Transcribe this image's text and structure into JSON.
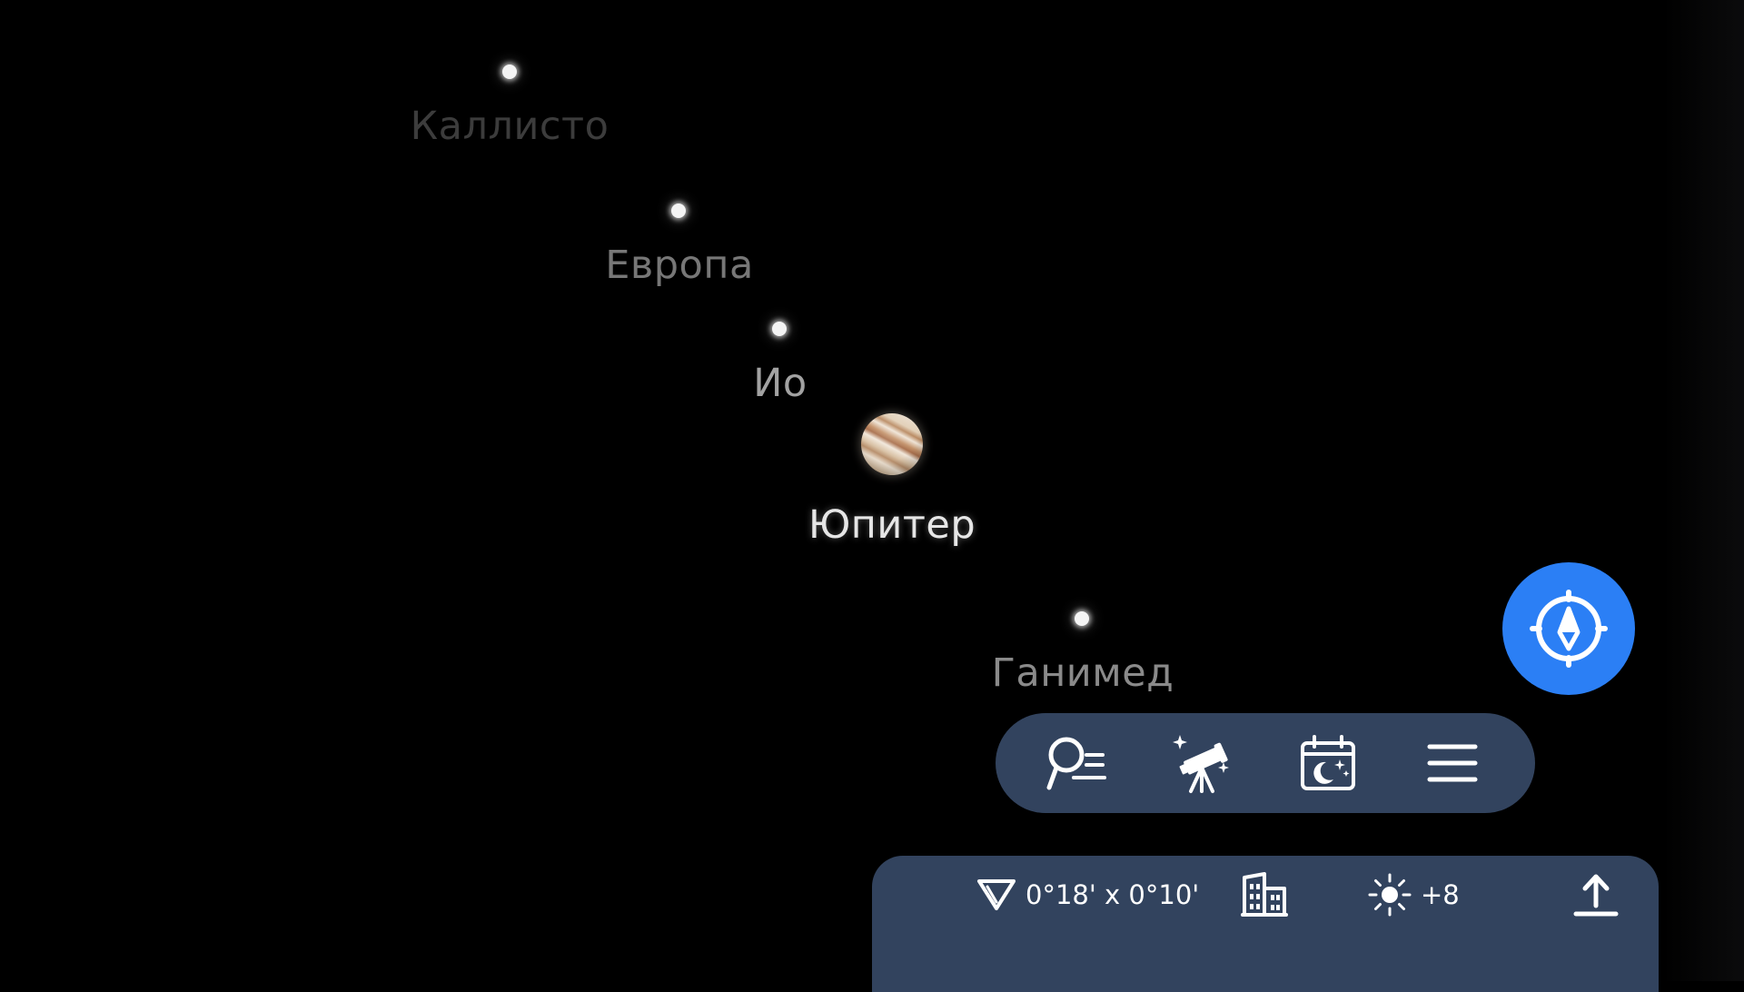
{
  "sky": {
    "background": "#000000",
    "objects": [
      {
        "name": "Каллисто",
        "label_color": "#3c3c3c"
      },
      {
        "name": "Европа",
        "label_color": "#777777"
      },
      {
        "name": "Ио",
        "label_color": "#a2a2a2"
      },
      {
        "name": "Юпитер",
        "label_color": "#e6e6e6"
      },
      {
        "name": "Ганимед",
        "label_color": "#8a8a8a"
      }
    ]
  },
  "compass_button": {
    "icon": "compass-icon",
    "color": "#2b7ff5"
  },
  "toolbar": {
    "background": "#32435e",
    "buttons": [
      {
        "icon": "search-list-icon"
      },
      {
        "icon": "telescope-icon"
      },
      {
        "icon": "calendar-night-icon"
      },
      {
        "icon": "menu-icon"
      }
    ]
  },
  "status_panel": {
    "background": "#32435e",
    "field_of_view": "0°18' x 0°10'",
    "landscape_icon": "buildings-icon",
    "brightness_icon": "sun-icon",
    "brightness_value": "+8",
    "share_icon": "upload-icon"
  }
}
